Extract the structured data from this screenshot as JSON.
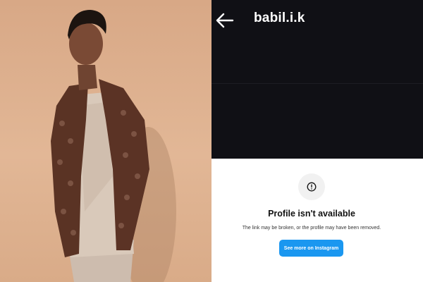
{
  "header": {
    "back_icon": "arrow-left-icon",
    "username": "babil.i.k"
  },
  "notice": {
    "icon": "alert-circle-icon",
    "title": "Profile isn't available",
    "message": "The link may be broken, or the profile may have been removed.",
    "button_label": "See more on Instagram",
    "button_color": "#1a97f0"
  },
  "colors": {
    "header_bg": "#101015",
    "page_bg": "#ffffff",
    "photo_bg": "#dcae8c"
  }
}
